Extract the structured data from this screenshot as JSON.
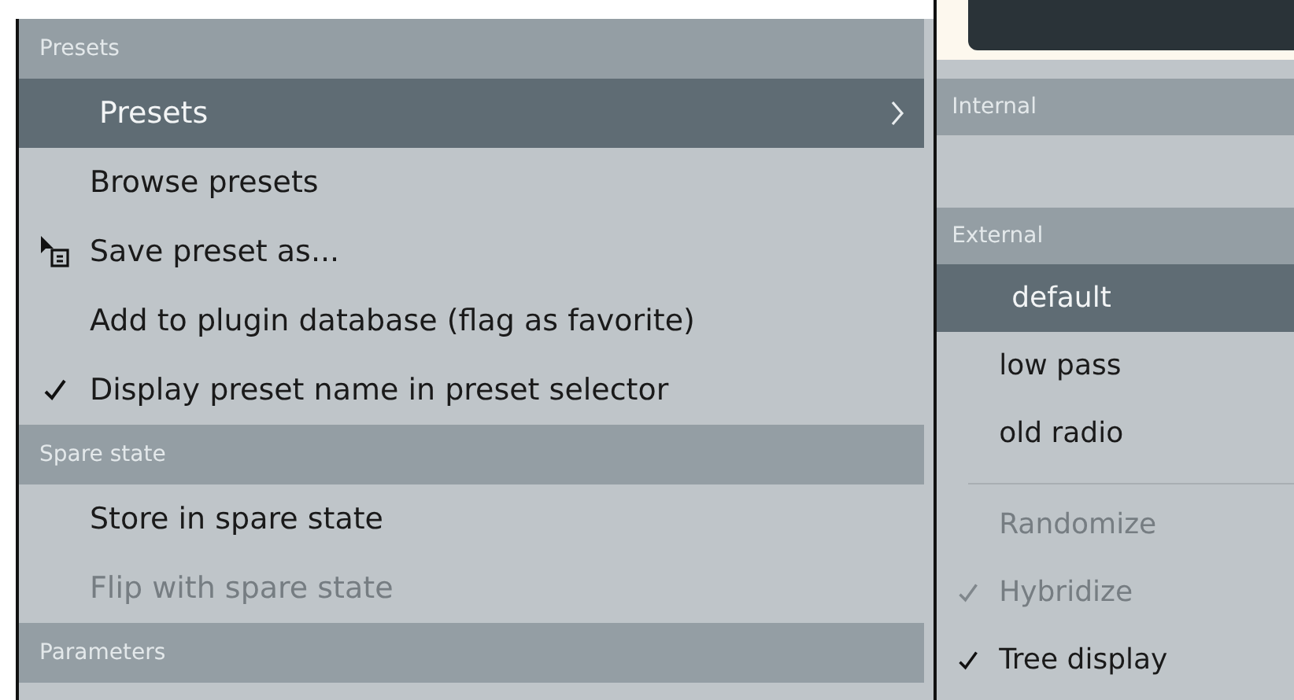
{
  "left_menu": {
    "sections": [
      {
        "header": "Presets",
        "items": [
          {
            "label": "Presets",
            "kind": "submenu",
            "selected": true,
            "checked": false,
            "disabled": false,
            "icon": false
          },
          {
            "label": "Browse presets",
            "kind": "command",
            "selected": false,
            "checked": false,
            "disabled": false,
            "icon": false
          },
          {
            "label": "Save preset as...",
            "kind": "command",
            "selected": false,
            "checked": false,
            "disabled": false,
            "icon": true
          },
          {
            "label": "Add to plugin database (flag as favorite)",
            "kind": "command",
            "selected": false,
            "checked": false,
            "disabled": false,
            "icon": false
          },
          {
            "label": "Display preset name in preset selector",
            "kind": "command",
            "selected": false,
            "checked": true,
            "disabled": false,
            "icon": false
          }
        ]
      },
      {
        "header": "Spare state",
        "items": [
          {
            "label": "Store in spare state",
            "kind": "command",
            "selected": false,
            "checked": false,
            "disabled": false,
            "icon": false
          },
          {
            "label": "Flip with spare state",
            "kind": "command",
            "selected": false,
            "checked": false,
            "disabled": true,
            "icon": false
          }
        ]
      },
      {
        "header": "Parameters"
      }
    ]
  },
  "right_menu": {
    "sections": [
      {
        "header": "Internal"
      },
      {
        "header": "External",
        "items": [
          {
            "label": "default",
            "selected": true,
            "checked": false,
            "disabled": false
          },
          {
            "label": "low pass",
            "selected": false,
            "checked": false,
            "disabled": false
          },
          {
            "label": "old radio",
            "selected": false,
            "checked": false,
            "disabled": false
          }
        ]
      },
      {
        "separator": true,
        "items": [
          {
            "label": "Randomize",
            "selected": false,
            "checked": false,
            "disabled": true
          },
          {
            "label": "Hybridize",
            "selected": false,
            "checked": true,
            "disabled": true
          },
          {
            "label": "Tree display",
            "selected": false,
            "checked": true,
            "disabled": false
          }
        ]
      }
    ]
  }
}
